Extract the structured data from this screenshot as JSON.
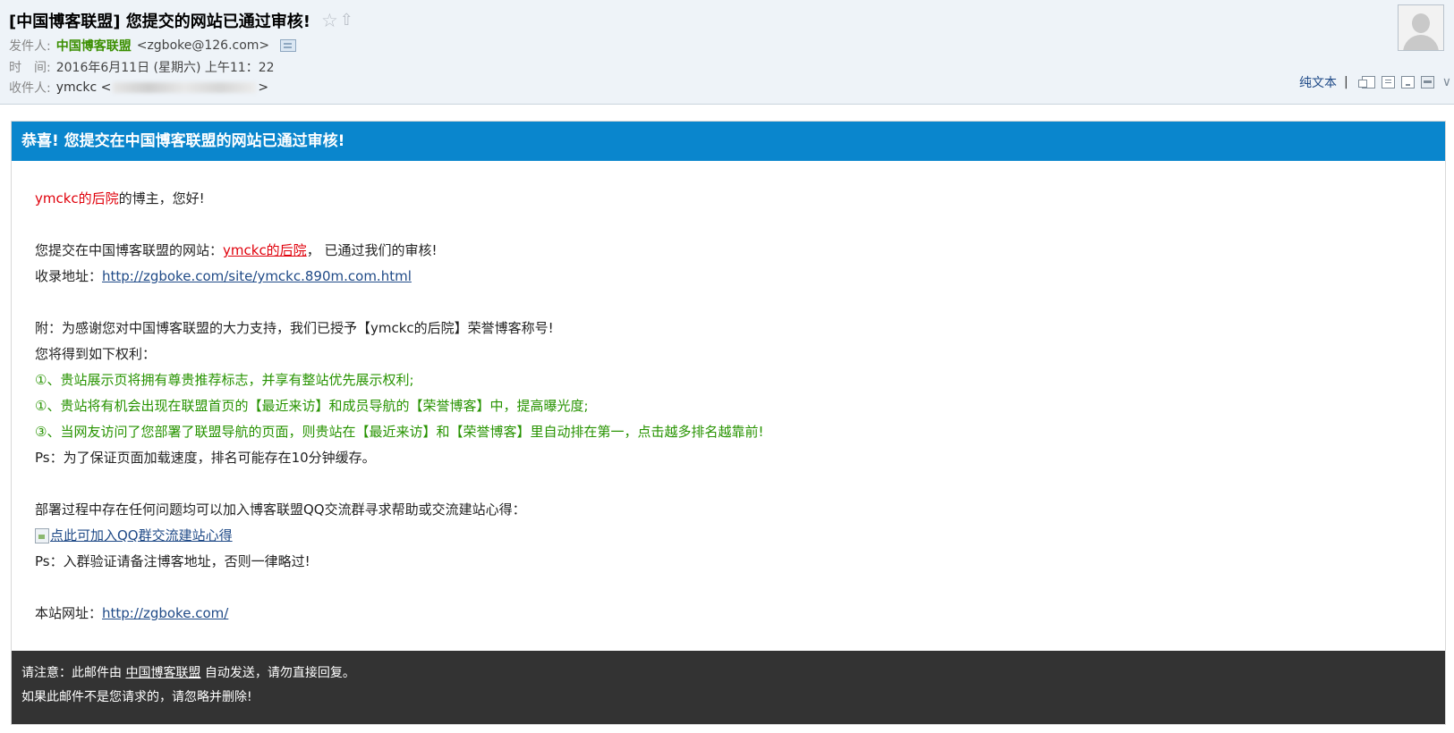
{
  "header": {
    "subject": "[中国博客联盟] 您提交的网站已通过审核!",
    "star_icon": "☆",
    "up_icon": "⇧",
    "from_label": "发件人:",
    "from_name": "中国博客联盟",
    "from_email": "<zgboke@126.com>",
    "time_label": "时　间:",
    "time_value": "2016年6月11日 (星期六) 上午11：22",
    "to_label": "收件人:",
    "to_name": "ymckc <",
    "to_end": ">",
    "plain_text_label": "纯文本",
    "separator": "|",
    "collapse_icon": "∨"
  },
  "mail": {
    "banner_title": "恭喜! 您提交在中国博客联盟的网站已通过审核!",
    "greeting_name": "ymckc的后院",
    "greeting_rest": "的博主，您好!",
    "submitted_prefix": "您提交在中国博客联盟的网站：",
    "submitted_site": "ymckc的后院",
    "submitted_suffix": "，  已通过我们的审核!",
    "url_label": "收录地址：",
    "url": "http://zgboke.com/site/ymckc.890m.com.html",
    "note_line": "附：为感谢您对中国博客联盟的大力支持，我们已授予【ymckc的后院】荣誉博客称号!",
    "rights_intro": "您将得到如下权利：",
    "rights": [
      "①、贵站展示页将拥有尊贵推荐标志，并享有整站优先展示权利;",
      "①、贵站将有机会出现在联盟首页的【最近来访】和成员导航的【荣誉博客】中，提高曝光度;",
      "③、当网友访问了您部署了联盟导航的页面，则贵站在【最近来访】和【荣誉博客】里自动排在第一，点击越多排名越靠前!"
    ],
    "ps1": "Ps：为了保证页面加载速度，排名可能存在10分钟缓存。",
    "help_line": "部署过程中存在任何问题均可以加入博客联盟QQ交流群寻求帮助或交流建站心得：",
    "qq_link": "点此可加入QQ群交流建站心得",
    "ps2": "Ps：入群验证请备注博客地址，否则一律略过!",
    "site_label": "本站网址：",
    "site_url": "http://zgboke.com/"
  },
  "footer": {
    "line1_prefix": "请注意：此邮件由",
    "line1_link": "中国博客联盟",
    "line1_suffix": "自动发送，请勿直接回复。",
    "line2": "如果此邮件不是您请求的，请忽略并删除!"
  },
  "colors": {
    "banner": "#0a86cd",
    "footer": "#333333",
    "red": "#e0000b",
    "green": "#279300",
    "link": "#1f4a87"
  }
}
